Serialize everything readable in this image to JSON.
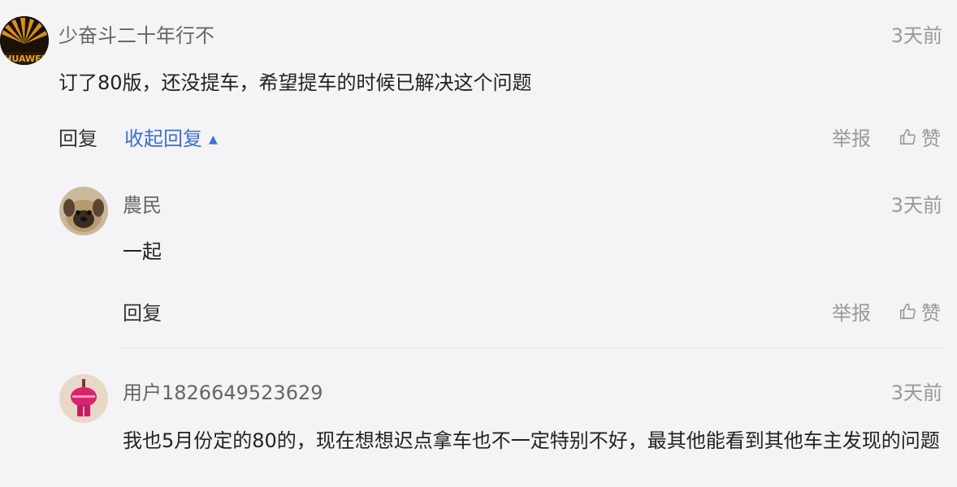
{
  "comments": [
    {
      "username": "少奋斗二十年行不",
      "time": "3天前",
      "content": "订了80版，还没提车，希望提车的时候已解决这个问题",
      "reply_label": "回复",
      "collapse_label": "收起回复",
      "report_label": "举报",
      "like_label": "赞"
    },
    {
      "username": "農民",
      "time": "3天前",
      "content": "一起",
      "reply_label": "回复",
      "report_label": "举报",
      "like_label": "赞"
    },
    {
      "username": "用户1826649523629",
      "time": "3天前",
      "content": "我也5月份定的80的，现在想想迟点拿车也不一定特别不好，最其他能看到其他车主发现的问题"
    }
  ],
  "colors": {
    "accent": "#3e6ed8",
    "background": "#f4f4f6",
    "muted": "#999999"
  }
}
